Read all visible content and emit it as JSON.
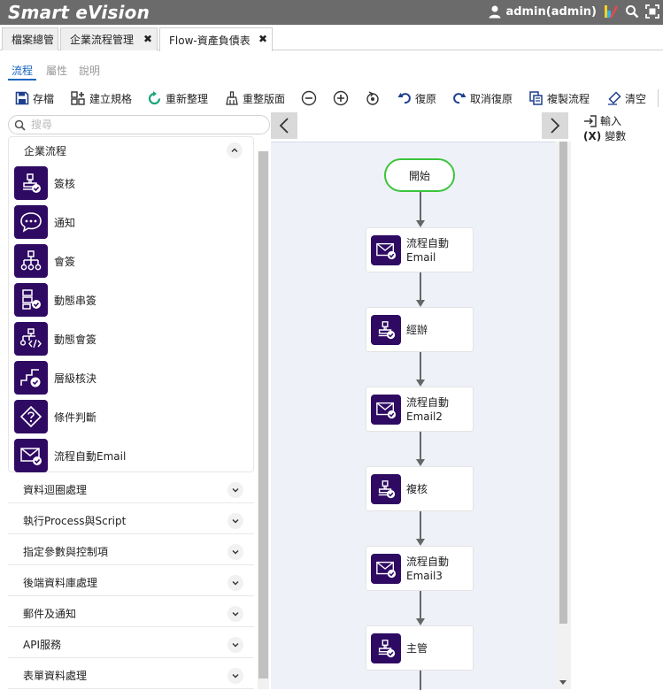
{
  "app": {
    "title": "Smart eVision",
    "user": "admin(admin)"
  },
  "tabs": [
    {
      "label": "檔案總管",
      "closable": false
    },
    {
      "label": "企業流程管理",
      "closable": true
    },
    {
      "label": "Flow-資產負債表",
      "closable": true,
      "active": true
    }
  ],
  "subtabs": [
    "流程",
    "屬性",
    "說明"
  ],
  "toolbar": {
    "save": "存檔",
    "create_spec": "建立規格",
    "reorganize": "重新整理",
    "reset_layout": "重整版面",
    "undo": "復原",
    "redo": "取消復原",
    "copy_flow": "複製流程",
    "clear": "清空"
  },
  "search": {
    "placeholder": "搜尋"
  },
  "palette": {
    "open_group": "企業流程",
    "items": [
      "簽核",
      "通知",
      "會簽",
      "動態串簽",
      "動態會簽",
      "層級核決",
      "條件判斷",
      "流程自動Email"
    ],
    "groups": [
      "資料迴圈處理",
      "執行Process與Script",
      "指定參數與控制項",
      "後端資料庫處理",
      "郵件及通知",
      "API服務",
      "表單資料處理"
    ]
  },
  "flow": {
    "start": "開始",
    "nodes": [
      {
        "type": "email",
        "label": "流程自動\nEmail"
      },
      {
        "type": "stamp",
        "label": "經辦"
      },
      {
        "type": "email",
        "label": "流程自動\nEmail2"
      },
      {
        "type": "stamp",
        "label": "複核"
      },
      {
        "type": "email",
        "label": "流程自動\nEmail3"
      },
      {
        "type": "stamp",
        "label": "主管"
      }
    ]
  },
  "rightpanel": {
    "input": "輸入",
    "variable_prefix": "(X)",
    "variable": "變數"
  },
  "colors": {
    "topbar": "#6b6b6b",
    "accent": "#1565c0",
    "icon_bg": "#2e0a63",
    "start_border": "#3cc43c",
    "canvas_bg": "#eef1f8"
  }
}
